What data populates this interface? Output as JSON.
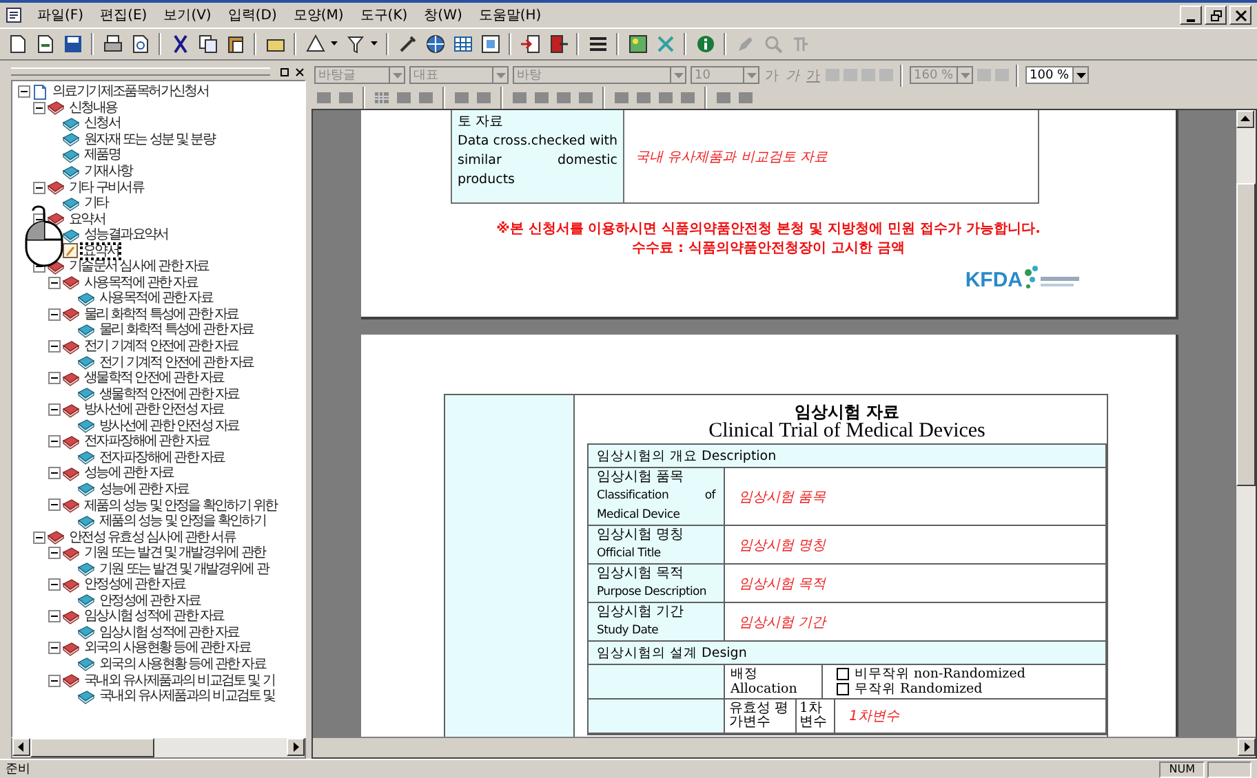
{
  "menu": [
    "파일(F)",
    "편집(E)",
    "보기(V)",
    "입력(D)",
    "모양(M)",
    "도구(K)",
    "창(W)",
    "도움말(H)"
  ],
  "format_bar": {
    "dropdowns": [
      {
        "value": "바탕글",
        "disabled": true
      },
      {
        "value": "대표",
        "disabled": true
      },
      {
        "value": "바탕",
        "disabled": true
      },
      {
        "value": "10",
        "disabled": true
      }
    ],
    "char_buttons": [
      "가",
      "가",
      "가"
    ],
    "ratio": {
      "value": "160 %",
      "disabled": true
    },
    "zoom": {
      "value": "100 %",
      "disabled": false
    }
  },
  "tree": {
    "label": "의료기기제조품목허가신청서",
    "kind": "document",
    "expanded": true,
    "selected": false,
    "children": [
      {
        "label": "신청내용",
        "kind": "section",
        "expanded": true,
        "selected": false,
        "children": [
          {
            "label": "신청서",
            "kind": "item",
            "selected": false
          },
          {
            "label": "원자재 또는 성분 및 분량",
            "kind": "item",
            "selected": false
          },
          {
            "label": "제품명",
            "kind": "item",
            "selected": false
          },
          {
            "label": "기재사항",
            "kind": "item",
            "selected": false
          }
        ]
      },
      {
        "label": "기타 구비서류",
        "kind": "section",
        "expanded": true,
        "selected": false,
        "children": [
          {
            "label": "기타",
            "kind": "item",
            "selected": false
          }
        ]
      },
      {
        "label": "요약서",
        "kind": "section",
        "expanded": true,
        "selected": false,
        "children": [
          {
            "label": "성능결과요약서",
            "kind": "item",
            "selected": false
          },
          {
            "label": "요약서",
            "kind": "edit",
            "selected": true
          }
        ]
      },
      {
        "label": "기술문서 심사에 관한 자료",
        "kind": "section",
        "expanded": true,
        "selected": false,
        "children": [
          {
            "label": "사용목적에 관한 자료",
            "kind": "section",
            "expanded": true,
            "selected": false,
            "children": [
              {
                "label": "사용목적에 관한 자료",
                "kind": "item",
                "selected": false
              }
            ]
          },
          {
            "label": "물리 화학적 특성에 관한 자료",
            "kind": "section",
            "expanded": true,
            "selected": false,
            "children": [
              {
                "label": "물리 화학적 특성에 관한 자료",
                "kind": "item",
                "selected": false
              }
            ]
          },
          {
            "label": "전기 기계적 안전에 관한 자료",
            "kind": "section",
            "expanded": true,
            "selected": false,
            "children": [
              {
                "label": "전기 기계적 안전에 관한 자료",
                "kind": "item",
                "selected": false
              }
            ]
          },
          {
            "label": "생물학적 안전에 관한 자료",
            "kind": "section",
            "expanded": true,
            "selected": false,
            "children": [
              {
                "label": "생물학적 안전에 관한 자료",
                "kind": "item",
                "selected": false
              }
            ]
          },
          {
            "label": "방사선에 관한 안전성 자료",
            "kind": "section",
            "expanded": true,
            "selected": false,
            "children": [
              {
                "label": "방사선에 관한 안전성 자료",
                "kind": "item",
                "selected": false
              }
            ]
          },
          {
            "label": "전자파장해에 관한 자료",
            "kind": "section",
            "expanded": true,
            "selected": false,
            "children": [
              {
                "label": "전자파장해에 관한 자료",
                "kind": "item",
                "selected": false
              }
            ]
          },
          {
            "label": "성능에 관한 자료",
            "kind": "section",
            "expanded": true,
            "selected": false,
            "children": [
              {
                "label": "성능에 관한 자료",
                "kind": "item",
                "selected": false
              }
            ]
          },
          {
            "label": "제품의 성능 및 안정을 확인하기 위한",
            "kind": "section",
            "expanded": true,
            "selected": false,
            "children": [
              {
                "label": "제품의 성능 및 안정을 확인하기",
                "kind": "item",
                "selected": false
              }
            ]
          }
        ]
      },
      {
        "label": "안전성 유효성 심사에 관한 서류",
        "kind": "section",
        "expanded": true,
        "selected": false,
        "children": [
          {
            "label": "기원 또는 발견 및 개발경위에 관한",
            "kind": "section",
            "expanded": true,
            "selected": false,
            "children": [
              {
                "label": "기원 또는 발견 및 개발경위에 관",
                "kind": "item",
                "selected": false
              }
            ]
          },
          {
            "label": "안정성에 관한 자료",
            "kind": "section",
            "expanded": true,
            "selected": false,
            "children": [
              {
                "label": "안정성에 관한 자료",
                "kind": "item",
                "selected": false
              }
            ]
          },
          {
            "label": "임상시험 성적에 관한 자료",
            "kind": "section",
            "expanded": true,
            "selected": false,
            "children": [
              {
                "label": "임상시험 성적에 관한 자료",
                "kind": "item",
                "selected": false
              }
            ]
          },
          {
            "label": "외국의 사용현황 등에 관한 자료",
            "kind": "section",
            "expanded": true,
            "selected": false,
            "children": [
              {
                "label": "외국의 사용현황 등에 관한 자료",
                "kind": "item",
                "selected": false
              }
            ]
          },
          {
            "label": "국내외 유사제품과의 비교검토 및 기",
            "kind": "section",
            "expanded": true,
            "selected": false,
            "children": [
              {
                "label": "국내외 유사제품과의 비교검토 및",
                "kind": "item",
                "selected": false
              }
            ]
          }
        ]
      }
    ]
  },
  "page1": {
    "label_ko": "토 자료",
    "label_en": "Data cross.checked with similar domestic products",
    "value": "국내 유사제품과 비교검토 자료",
    "notices": [
      "※본 신청서를 이용하시면 식품의약품안전청 본청 및 지방청에 민원 접수가 가능합니다.",
      "수수료 : 식품의약품안전청장이 고시한 금액"
    ],
    "logo": "KFDA"
  },
  "page2": {
    "title_ko": "임상시험 자료",
    "title_en": "Clinical Trial of Medical Devices",
    "rows": [
      {
        "kind": "section",
        "label": "임상시험의 개요 Description"
      },
      {
        "kind": "field",
        "label_ko": "임상시험 품목",
        "label_en": "Classification of Medical Device",
        "value": "임상시험 품목"
      },
      {
        "kind": "field",
        "label_ko": "임상시험 명칭",
        "label_en": "Official Title",
        "value": "임상시험 명칭"
      },
      {
        "kind": "field",
        "label_ko": "임상시험 목적",
        "label_en": "Purpose Description",
        "value": "임상시험 목적"
      },
      {
        "kind": "field",
        "label_ko": "임상시험 기간",
        "label_en": "Study Date",
        "value": "임상시험 기간"
      },
      {
        "kind": "section",
        "label": "임상시험의 설계 Design"
      },
      {
        "kind": "allocation",
        "label_ko": "배정",
        "label_en": "Allocation",
        "options": [
          {
            "label": "비무작위 non-Randomized",
            "checked": false
          },
          {
            "label": "무작위 Randomized",
            "checked": false
          }
        ]
      },
      {
        "kind": "variable",
        "group": "유효성 평가변수",
        "label": "1차 변수",
        "value": "1차변수"
      }
    ]
  },
  "status_bar": {
    "message": "준비",
    "num": "NUM"
  }
}
